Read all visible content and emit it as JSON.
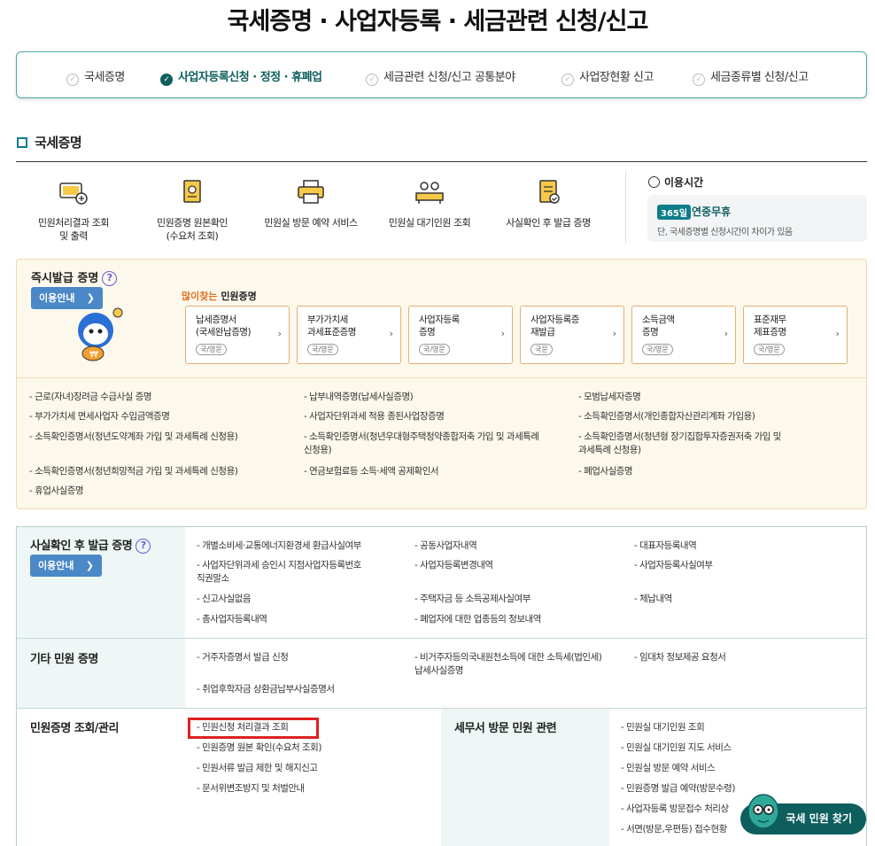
{
  "page_title": "국세증명 · 사업자등록 · 세금관련 신청/신고",
  "tabs": [
    {
      "label": "국세증명",
      "active": false
    },
    {
      "label": "사업자등록신청 · 정정 · 휴폐업",
      "active": true
    },
    {
      "label": "세금관련 신청/신고 공통분야",
      "active": false
    },
    {
      "label": "사업장현황 신고",
      "active": false
    },
    {
      "label": "세금종류별 신청/신고",
      "active": false
    }
  ],
  "section_title": "국세증명",
  "quick_links": [
    {
      "label": "민원처리결과 조회\n및 출력"
    },
    {
      "label": "민원증명 원본확인\n(수요처 조회)"
    },
    {
      "label": "민원실 방문 예약 서비스"
    },
    {
      "label": "민원실 대기인원 조회"
    },
    {
      "label": "사실확인 후 발급 증명"
    }
  ],
  "hours": {
    "label": "이용시간",
    "badge": "365일",
    "value": "연중무휴",
    "note": "단, 국세증명별 신청시간이 차이가 있음"
  },
  "instant": {
    "title": "즉시발급 증명",
    "guide_label": "이용안내",
    "popular_prefix": "많이찾는",
    "popular_suffix": " 민원증명",
    "cards": [
      {
        "name": "납세증명서\n(국세완납증명)",
        "tag": "국/영문"
      },
      {
        "name": "부가가치세\n과세표준증명",
        "tag": "국/영문"
      },
      {
        "name": "사업자등록\n증명",
        "tag": "국/영문"
      },
      {
        "name": "사업자등록증\n재발급",
        "tag": "국문"
      },
      {
        "name": "소득금액\n증명",
        "tag": "국/영문"
      },
      {
        "name": "표준재무\n제표증명",
        "tag": "국/영문"
      }
    ],
    "items": [
      "- 근로(자녀)장려금 수급사실 증명",
      "- 납부내역증명(납세사실증명)",
      "- 모범납세자증명",
      "- 부가가치세 면세사업자 수입금액증명",
      "- 사업자단위과세 적용 종된사업장증명",
      "- 소득확인증명서(개인종합자산관리계좌 가입용)",
      "- 소득확인증명서(청년도약계좌 가입 및 과세특례 신청용)",
      "- 소득확인증명서(청년우대형주택청약종합저축 가입 및 과세특례\n  신청용)",
      "- 소득확인증명서(청년형 장기집합투자증권저축 가입 및\n  과세특례 신청용)",
      "- 소득확인증명서(청년희망적금 가입 및 과세특례 신청용)",
      "- 연금보험료등 소득·세액 공제확인서",
      "- 폐업사실증명",
      "- 휴업사실증명"
    ]
  },
  "after_check": {
    "title": "사실확인 후 발급 증명",
    "guide_label": "이용안내",
    "items": [
      "- 개별소비세·교통에너지환경세 환급사실여부",
      "- 공동사업자내역",
      "- 대표자등록내역",
      "- 사업자단위과세 승인시 지점사업자등록번호\n  직권말소",
      "- 사업자등록변경내역",
      "- 사업자등록사실여부",
      "- 신고사실없음",
      "- 주택자금 등 소득공제사실여부",
      "- 체납내역",
      "- 총사업자등록내역",
      "- 폐업자에 대한 업종등의 정보내역"
    ]
  },
  "other": {
    "title": "기타 민원 증명",
    "items": [
      "- 거주자증명서 발급 신청",
      "- 비거주자등의국내원천소득에 대한 소득세(법인세)\n  납세사실증명",
      "- 임대차 정보제공 요청서",
      "- 취업후학자금 상환금납부사실증명서"
    ]
  },
  "manage": {
    "title": "민원증명 조회/관리",
    "items": [
      "- 민원신청 처리결과 조회",
      "- 민원증명 원본 확인(수요처 조회)",
      "- 민원서류 발급 제한 및 해지신고",
      "- 문서위변조방지 및 처벌안내"
    ]
  },
  "visit": {
    "title": "세무서 방문 민원 관련",
    "items": [
      "- 민원실 대기인원 조회",
      "- 민원실 대기인원 지도 서비스",
      "- 민원실 방문 예약 서비스",
      "- 민원증명 발급 예약(방문수령)",
      "- 사업자등록 방문접수 처리상",
      "- 서면(방문,우편등) 접수현황"
    ]
  },
  "find_button": "국세 민원 찾기",
  "colors": {
    "accent": "#0e5e5e",
    "guide_button": "#4a88c7",
    "highlight": "#e07020",
    "red_box": "#e02020"
  }
}
